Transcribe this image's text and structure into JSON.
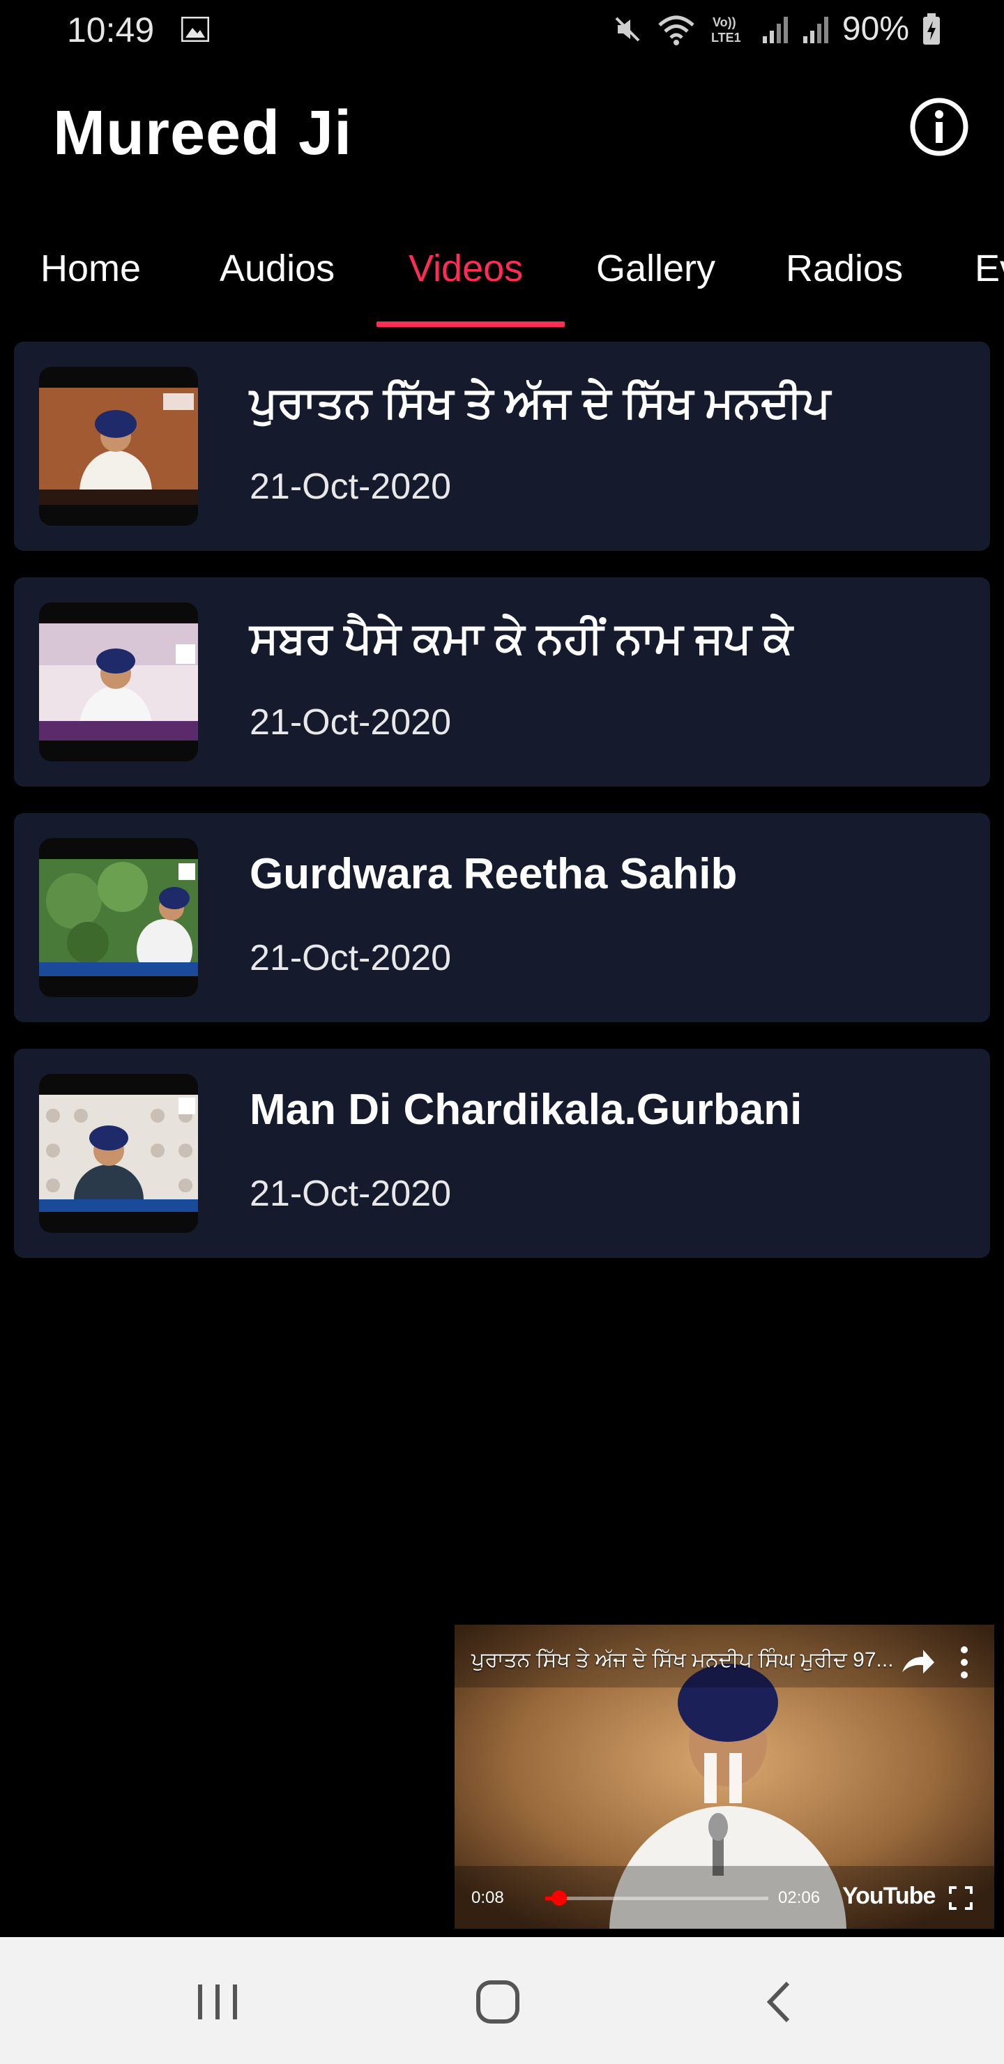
{
  "status_bar": {
    "time": "10:49",
    "battery": "90%",
    "icons": [
      "gallery-icon",
      "mute-icon",
      "wifi-icon",
      "volte-icon",
      "signal-icon",
      "signal-icon",
      "battery-icon"
    ]
  },
  "header": {
    "title": "Mureed Ji",
    "info_icon": "info-icon"
  },
  "tabs": [
    {
      "label": "Home"
    },
    {
      "label": "Audios"
    },
    {
      "label": "Videos",
      "active": true
    },
    {
      "label": "Gallery"
    },
    {
      "label": "Radios"
    },
    {
      "label": "Ev"
    }
  ],
  "videos": [
    {
      "title": "ਪੁਰਾਤਨ ਸਿੱਖ ਤੇ ਅੱਜ ਦੇ ਸਿੱਖ ਮਨਦੀਪ",
      "date": "21-Oct-2020"
    },
    {
      "title": "ਸਬਰ ਪੈਸੇ ਕਮਾ ਕੇ ਨਹੀਂ ਨਾਮ ਜਪ ਕੇ",
      "date": "21-Oct-2020"
    },
    {
      "title": "Gurdwara Reetha Sahib",
      "date": "21-Oct-2020"
    },
    {
      "title": "Man Di Chardikala.Gurbani",
      "date": "21-Oct-2020"
    }
  ],
  "player": {
    "title": "ਪੁਰਾਤਨ ਸਿੱਖ ਤੇ ਅੱਜ ਦੇ ਸਿੱਖ ਮਨਦੀਪ ਸਿੰਘ ਮੁਰੀਦ 97...",
    "current_time": "0:08",
    "duration": "02:06",
    "progress_fraction": 0.063,
    "brand": "YouTube"
  },
  "colors": {
    "accent": "#ff2d55",
    "card_bg": "#151b2d",
    "background": "#000000"
  }
}
